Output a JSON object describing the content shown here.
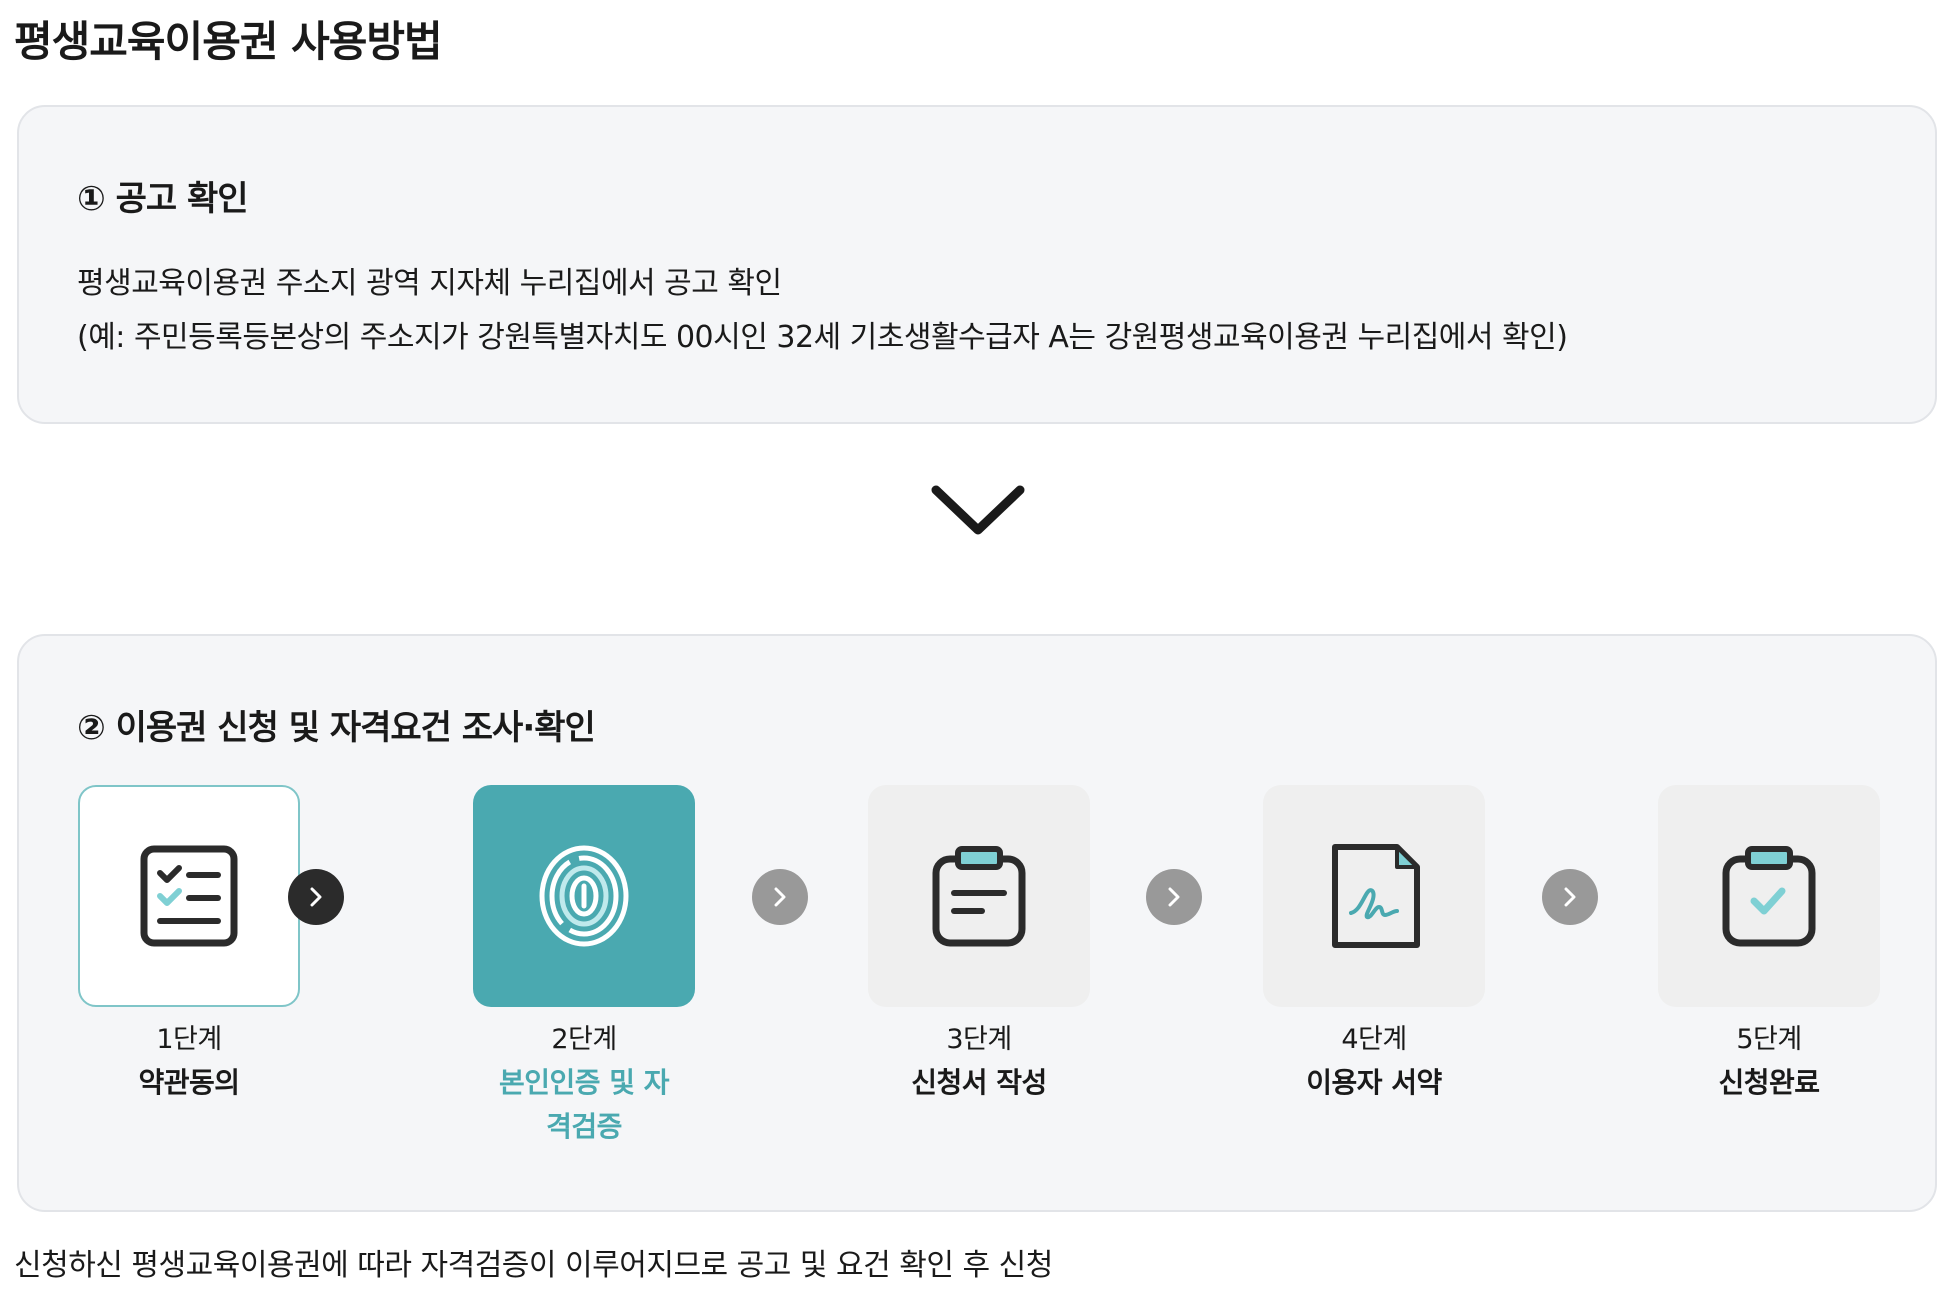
{
  "page_title": "평생교육이용권 사용방법",
  "section1": {
    "heading": "① 공고 확인",
    "lines": [
      "평생교육이용권 주소지 광역 지자체 누리집에서 공고 확인",
      "(예: 주민등록등본상의 주소지가 강원특별자치도 00시인 32세 기초생활수급자 A는 강원평생교육이용권 누리집에서 확인)"
    ]
  },
  "section2": {
    "heading": "② 이용권 신청 및 자격요건 조사·확인",
    "steps": [
      {
        "number": "1단계",
        "name": "약관동의",
        "icon": "checklist-icon"
      },
      {
        "number": "2단계",
        "name": "본인인증 및 자격검증",
        "icon": "fingerprint-icon"
      },
      {
        "number": "3단계",
        "name": "신청서 작성",
        "icon": "clipboard-form-icon"
      },
      {
        "number": "4단계",
        "name": "이용자 서약",
        "icon": "signed-document-icon"
      },
      {
        "number": "5단계",
        "name": "신청완료",
        "icon": "clipboard-check-icon"
      }
    ]
  },
  "footer_note": "신청하신 평생교육이용권에 따라 자격검증이 이루어지므로 공고 및 요건 확인 후 신청",
  "colors": {
    "accent": "#4aa9b0",
    "accent_light": "#7fd0d4",
    "icon_dark": "#2b2b2b",
    "panel_bg": "#f5f6f8",
    "arrow_gray": "#999999"
  }
}
